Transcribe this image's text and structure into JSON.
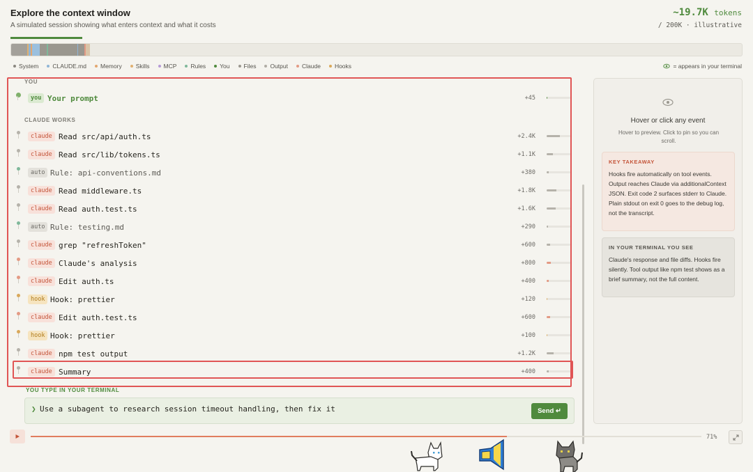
{
  "header": {
    "title": "Explore the context window",
    "subtitle": "A simulated session showing what enters context and what it costs",
    "tokens": "~19.7K",
    "tokens_unit": "tokens",
    "tokens_sub": "/ 200K · illustrative"
  },
  "legend": {
    "items": [
      {
        "label": "System",
        "color": "#8a8780"
      },
      {
        "label": "CLAUDE.md",
        "color": "#8fb5d6"
      },
      {
        "label": "Memory",
        "color": "#e3a76f"
      },
      {
        "label": "Skills",
        "color": "#e0b070"
      },
      {
        "label": "MCP",
        "color": "#b59ad6"
      },
      {
        "label": "Rules",
        "color": "#7fb89a"
      },
      {
        "label": "You",
        "color": "#4f8a3d"
      },
      {
        "label": "Files",
        "color": "#9a978f"
      },
      {
        "label": "Output",
        "color": "#b0ada5"
      },
      {
        "label": "Claude",
        "color": "#e39a84"
      },
      {
        "label": "Hooks",
        "color": "#d9a85a"
      }
    ],
    "terminal_note": "= appears in your terminal"
  },
  "sections": {
    "you": "YOU",
    "claude_works": "CLAUDE WORKS"
  },
  "events": [
    {
      "badge": "you",
      "text": "Your prompt",
      "tokens": "+45",
      "fill": 0.02,
      "color": "#4f8a3d",
      "visible": true
    },
    {
      "badge": "claude",
      "text": "Read src/api/auth.ts",
      "tokens": "+2.4K",
      "fill": 0.55,
      "color": "#b5b2aa",
      "visible": false
    },
    {
      "badge": "claude",
      "text": "Read src/lib/tokens.ts",
      "tokens": "+1.1K",
      "fill": 0.25,
      "color": "#b5b2aa",
      "visible": false
    },
    {
      "badge": "auto",
      "text": "Rule: api-conventions.md",
      "tokens": "+380",
      "fill": 0.09,
      "color": "#b5b2aa",
      "visible": false
    },
    {
      "badge": "claude",
      "text": "Read middleware.ts",
      "tokens": "+1.8K",
      "fill": 0.42,
      "color": "#b5b2aa",
      "visible": false
    },
    {
      "badge": "claude",
      "text": "Read auth.test.ts",
      "tokens": "+1.6K",
      "fill": 0.37,
      "color": "#b5b2aa",
      "visible": false
    },
    {
      "badge": "auto",
      "text": "Rule: testing.md",
      "tokens": "+290",
      "fill": 0.07,
      "color": "#b5b2aa",
      "visible": false
    },
    {
      "badge": "claude",
      "text": "grep \"refreshToken\"",
      "tokens": "+600",
      "fill": 0.14,
      "color": "#b5b2aa",
      "visible": false
    },
    {
      "badge": "claude",
      "text": "Claude's analysis",
      "tokens": "+800",
      "fill": 0.19,
      "color": "#e39a84",
      "visible": true
    },
    {
      "badge": "claude",
      "text": "Edit auth.ts",
      "tokens": "+400",
      "fill": 0.09,
      "color": "#e39a84",
      "visible": true
    },
    {
      "badge": "hook",
      "text": "Hook: prettier",
      "tokens": "+120",
      "fill": 0.03,
      "color": "#d9a85a",
      "visible": false
    },
    {
      "badge": "claude",
      "text": "Edit auth.test.ts",
      "tokens": "+600",
      "fill": 0.14,
      "color": "#e39a84",
      "visible": true
    },
    {
      "badge": "hook",
      "text": "Hook: prettier",
      "tokens": "+100",
      "fill": 0.02,
      "color": "#d9a85a",
      "visible": false
    },
    {
      "badge": "claude",
      "text": "npm test output",
      "tokens": "+1.2K",
      "fill": 0.28,
      "color": "#b5b2aa",
      "visible": false
    },
    {
      "badge": "claude",
      "text": "Summary",
      "tokens": "+400",
      "fill": 0.09,
      "color": "#b5b2aa",
      "visible": true
    }
  ],
  "terminal": {
    "label": "YOU TYPE IN YOUR TERMINAL",
    "prompt": "❯",
    "text": "Use a subagent to research session timeout handling, then fix it",
    "send": "Send ↵"
  },
  "playback": {
    "percent": "71%",
    "progress": 0.71
  },
  "side": {
    "title": "Hover or click any event",
    "hint": "Hover to preview. Click to pin so you can scroll.",
    "takeaway_title": "KEY TAKEAWAY",
    "takeaway_body": "Hooks fire automatically on tool events. Output reaches Claude via additionalContext JSON. Exit code 2 surfaces stderr to Claude. Plain stdout on exit 0 goes to the debug log, not the transcript.",
    "terminal_title": "IN YOUR TERMINAL YOU SEE",
    "terminal_body": "Claude's response and file diffs. Hooks fire silently. Tool output like npm test shows as a brief summary, not the full content."
  },
  "context_stack": [
    {
      "color": "#a3a09a",
      "share": 0.022
    },
    {
      "color": "#e0b070",
      "share": 0.002
    },
    {
      "color": "#8fb5d6",
      "share": 0.003
    },
    {
      "color": "#e3a76f",
      "share": 0.002
    },
    {
      "color": "#9bc0de",
      "share": 0.01
    },
    {
      "color": "#9a978f",
      "share": 0.01
    },
    {
      "color": "#7fb89a",
      "share": 0.002
    },
    {
      "color": "#9a978f",
      "share": 0.04
    },
    {
      "color": "#8fb5d6",
      "share": 0.001
    },
    {
      "color": "#9a978f",
      "share": 0.008
    },
    {
      "color": "#e39a84",
      "share": 0.002
    },
    {
      "color": "#d9c4a8",
      "share": 0.006
    }
  ]
}
